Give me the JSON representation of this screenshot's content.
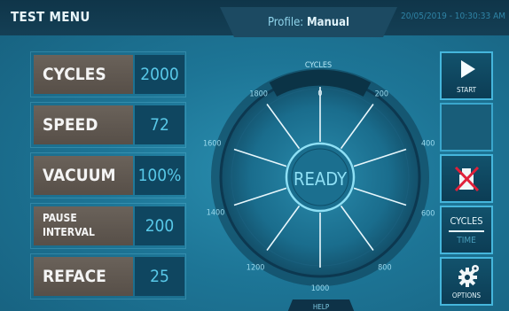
{
  "header": {
    "title": "TEST MENU",
    "profile_label": "Profile:",
    "profile_value": "Manual",
    "datetime": "20/05/2019 - 10:30:33 AM"
  },
  "params": [
    {
      "label": "CYCLES",
      "value": "2000"
    },
    {
      "label": "SPEED",
      "value": "72"
    },
    {
      "label": "VACUUM",
      "value": "100%"
    },
    {
      "label_line1": "PAUSE",
      "label_line2": "INTERVAL",
      "value": "200"
    },
    {
      "label": "REFACE",
      "value": "25"
    }
  ],
  "gauge": {
    "title": "CYCLES",
    "status": "READY",
    "ticks": [
      "0",
      "200",
      "400",
      "600",
      "800",
      "1000",
      "1200",
      "1400",
      "1600",
      "1800"
    ]
  },
  "side_buttons": {
    "start": "START",
    "cycles": "CYCLES",
    "time": "TIME",
    "options": "OPTIONS"
  },
  "footer": {
    "help": "HELP"
  },
  "colors": {
    "accent": "#45b6dc",
    "cancel": "#e0203a",
    "value_text": "#58c8e8"
  }
}
